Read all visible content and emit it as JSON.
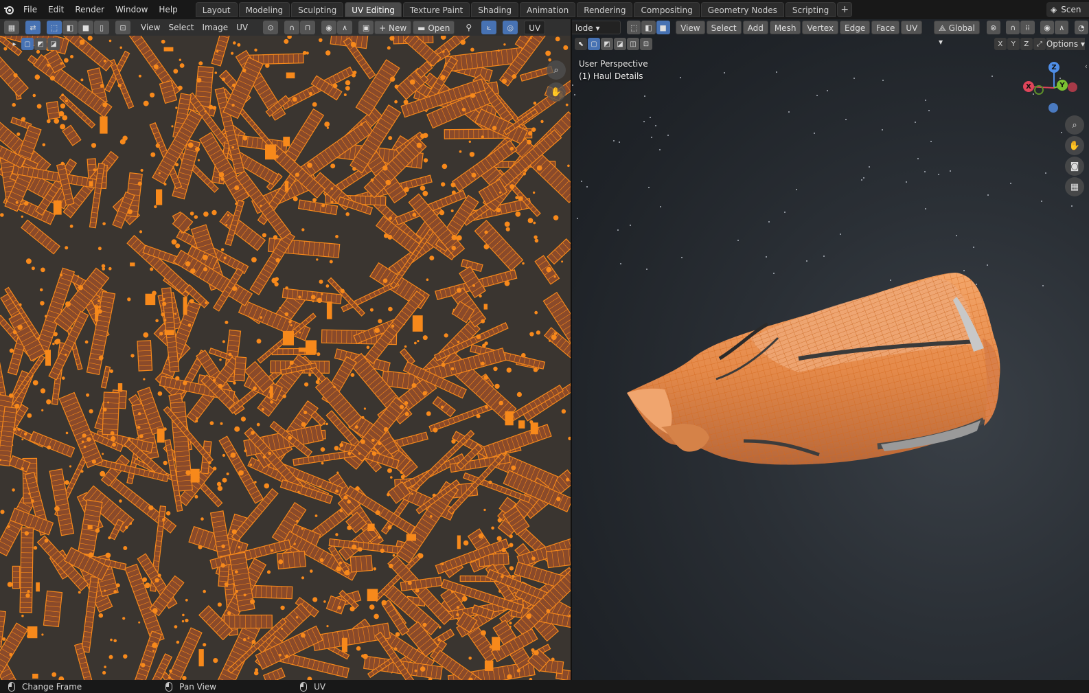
{
  "topbar": {
    "menus": [
      "File",
      "Edit",
      "Render",
      "Window",
      "Help"
    ],
    "workspaces": [
      "Layout",
      "Modeling",
      "Sculpting",
      "UV Editing",
      "Texture Paint",
      "Shading",
      "Animation",
      "Rendering",
      "Compositing",
      "Geometry Nodes",
      "Scripting"
    ],
    "active_workspace": "UV Editing",
    "add_label": "+",
    "scene_label": "Scen"
  },
  "uv_editor": {
    "menus": {
      "view": "View",
      "select": "Select",
      "image": "Image",
      "uv": "UV"
    },
    "new_label": "New",
    "open_label": "Open",
    "uv_label": "UV"
  },
  "viewport": {
    "mode_label": "lode",
    "menus": {
      "view": "View",
      "select": "Select",
      "add": "Add",
      "mesh": "Mesh",
      "vertex": "Vertex",
      "edge": "Edge",
      "face": "Face",
      "uv": "UV"
    },
    "transform_orientation": "Global",
    "axes": {
      "x": "X",
      "y": "Y",
      "z": "Z"
    },
    "options_label": "Options",
    "perspective_label": "User Perspective",
    "object_label": "(1) Haul Details"
  },
  "gizmo": {
    "x": "X",
    "y": "Y",
    "z": "Z"
  },
  "statusbar": {
    "items": [
      "Change Frame",
      "Pan View",
      "UV"
    ]
  },
  "colors": {
    "accent": "#4772b3",
    "uv_orange": "#f7891b",
    "island_fill": "#8a4a2a",
    "mesh_orange": "#e8894a"
  }
}
